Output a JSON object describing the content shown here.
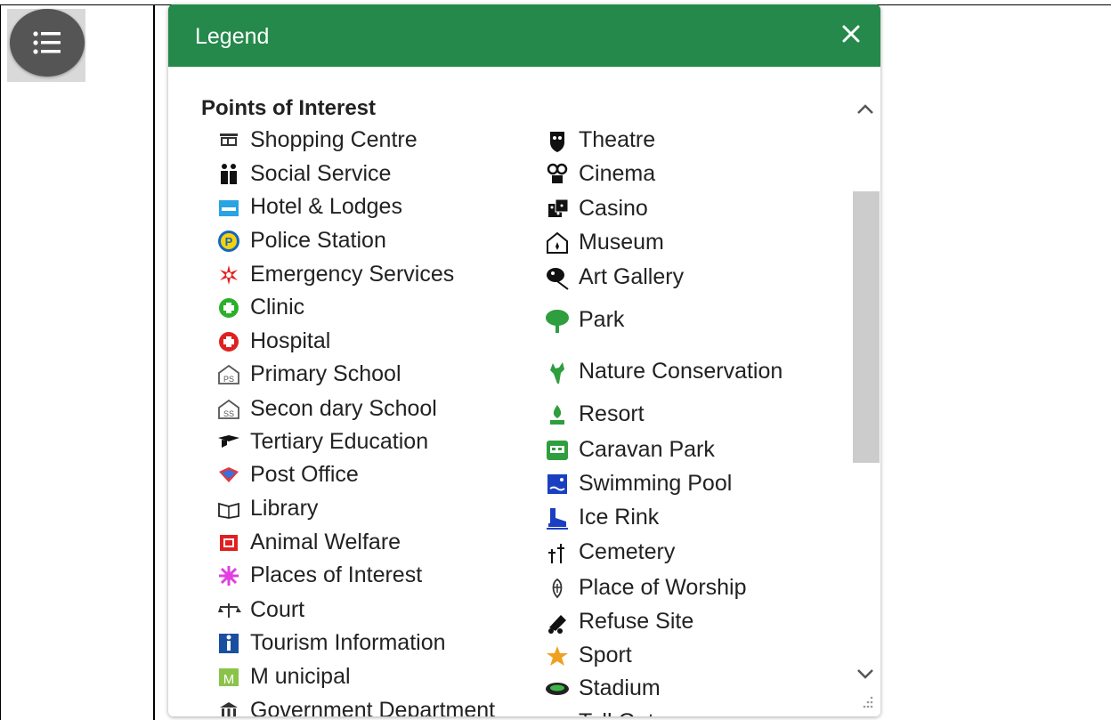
{
  "legend_panel": {
    "title": "Legend",
    "close_label": "✕",
    "section_title": "Points of Interest",
    "left_items": [
      {
        "label": "Shopping Centre",
        "icon": "shopping-centre-icon",
        "color": "#333333"
      },
      {
        "label": "Social Service",
        "icon": "social-service-icon",
        "color": "#111111"
      },
      {
        "label": "Hotel & Lodges",
        "icon": "hotel-icon",
        "color": "#29a3e3"
      },
      {
        "label": "Police Station",
        "icon": "police-station-icon",
        "color": "#1565c0"
      },
      {
        "label": "Emergency Services",
        "icon": "emergency-services-icon",
        "color": "#e32020"
      },
      {
        "label": "Clinic",
        "icon": "clinic-icon",
        "color": "#2bb02b"
      },
      {
        "label": "Hospital",
        "icon": "hospital-icon",
        "color": "#e02020"
      },
      {
        "label": "Primary School",
        "icon": "primary-school-icon",
        "color": "#555555"
      },
      {
        "label": "Secon dary School",
        "icon": "secondary-school-icon",
        "color": "#555555"
      },
      {
        "label": "Tertiary Education",
        "icon": "tertiary-education-icon",
        "color": "#111111"
      },
      {
        "label": "Post Office",
        "icon": "post-office-icon",
        "color": "#e03a3a"
      },
      {
        "label": "Library",
        "icon": "library-icon",
        "color": "#222222"
      },
      {
        "label": "Animal Welfare",
        "icon": "animal-welfare-icon",
        "color": "#e02020"
      },
      {
        "label": "Places of Interest",
        "icon": "places-of-interest-icon",
        "color": "#e040e0"
      },
      {
        "label": "Court",
        "icon": "court-icon",
        "color": "#333333"
      },
      {
        "label": "Tourism Information",
        "icon": "tourism-information-icon",
        "color": "#1a4fa0"
      },
      {
        "label": "M unicipal",
        "icon": "municipal-icon",
        "color": "#8bc34a"
      },
      {
        "label": "Government Department",
        "icon": "government-department-icon",
        "color": "#333333"
      }
    ],
    "right_items": [
      {
        "label": "Theatre",
        "icon": "theatre-icon",
        "color": "#111111"
      },
      {
        "label": "Cinema",
        "icon": "cinema-icon",
        "color": "#111111"
      },
      {
        "label": "Casino",
        "icon": "casino-icon",
        "color": "#111111"
      },
      {
        "label": "Museum",
        "icon": "museum-icon",
        "color": "#111111"
      },
      {
        "label": "Art Gallery",
        "icon": "art-gallery-icon",
        "color": "#111111"
      },
      {
        "label": "Park",
        "icon": "park-icon",
        "color": "#2e9e3e"
      },
      {
        "label": "Nature Conservation",
        "icon": "nature-conservation-icon",
        "color": "#2e9e3e"
      },
      {
        "label": "Resort",
        "icon": "resort-icon",
        "color": "#2e9e3e"
      },
      {
        "label": "Caravan Park",
        "icon": "caravan-park-icon",
        "color": "#2e9e3e"
      },
      {
        "label": "Swimming Pool",
        "icon": "swimming-pool-icon",
        "color": "#1a3fc0"
      },
      {
        "label": "Ice Rink",
        "icon": "ice-rink-icon",
        "color": "#1a3fc0"
      },
      {
        "label": "Cemetery",
        "icon": "cemetery-icon",
        "color": "#111111"
      },
      {
        "label": "Place of Worship",
        "icon": "place-of-worship-icon",
        "color": "#333333"
      },
      {
        "label": "Refuse Site",
        "icon": "refuse-site-icon",
        "color": "#111111"
      },
      {
        "label": "Sport",
        "icon": "sport-icon",
        "color": "#f0a020"
      },
      {
        "label": "Stadium",
        "icon": "stadium-icon",
        "color": "#222222"
      },
      {
        "label": "Toll Gate",
        "icon": "toll-gate-icon",
        "color": "#e8c020"
      }
    ]
  }
}
